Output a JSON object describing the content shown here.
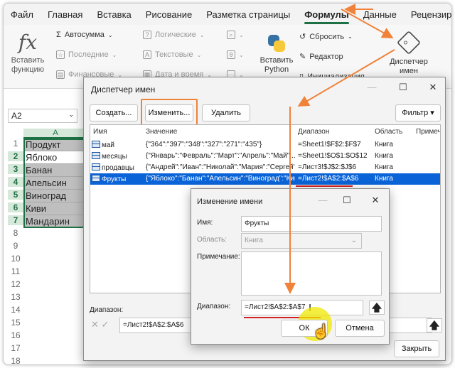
{
  "menu": [
    "Файл",
    "Главная",
    "Вставка",
    "Рисование",
    "Разметка страницы",
    "Формулы",
    "Данные",
    "Рецензиров"
  ],
  "ribbon": {
    "insert_function": "Вставить функцию",
    "fx": "fx",
    "autosum": "Автосумма",
    "recent": "Последние",
    "financial": "Финансовые",
    "logical": "Логические",
    "text": "Текстовые",
    "date_time": "Дата и время",
    "insert_python": "Вставить Python",
    "reset": "Сбросить",
    "editor": "Редактор",
    "init": "Инициализация",
    "name_manager": "Диспетчер имен"
  },
  "namebox": "A2",
  "sheet": {
    "column": "A",
    "rows": [
      "1",
      "2",
      "3",
      "4",
      "5",
      "6",
      "7",
      "8",
      "9",
      "10",
      "11",
      "12",
      "13",
      "14",
      "15",
      "16",
      "17",
      "18"
    ],
    "cells": [
      "Продукт",
      "Яблоко",
      "Банан",
      "Апельсин",
      "Виноград",
      "Киви",
      "Мандарин"
    ]
  },
  "name_manager": {
    "title": "Диспетчер имен",
    "create": "Создать...",
    "edit": "Изменить...",
    "delete": "Удалить",
    "filter": "Фильтр ▾",
    "headers": [
      "Имя",
      "Значение",
      "Диапазон",
      "Область",
      "Примеч"
    ],
    "rows": [
      {
        "name": "май",
        "value": "{\"364\":\"397\":\"348\":\"327\":\"271\":\"435\"}",
        "range": "=Sheet1!$F$2:$F$7",
        "scope": "Книга"
      },
      {
        "name": "месяцы",
        "value": "{\"Январь\":\"Февраль\":\"Март\":\"Апрель\":\"Май\":...",
        "range": "=Sheet1!$O$1:$O$12",
        "scope": "Книга"
      },
      {
        "name": "продавцы",
        "value": "{\"Андрей\":\"Иван\":\"Николай\":\"Мария\":\"Сергей\"}",
        "range": "=Лист3!$J$2:$J$6",
        "scope": "Книга"
      },
      {
        "name": "Фрукты",
        "value": "{\"Яблоко\":\"Банан\":\"Апельсин\":\"Виноград\":\"Кив...",
        "range": "=Лист2!$A$2:$A$6",
        "scope": "Книга"
      }
    ],
    "range_label": "Диапазон:",
    "range_value": "=Лист2!$A$2:$A$6",
    "close": "Закрыть"
  },
  "edit_dialog": {
    "title": "Изменение имени",
    "name_label": "Имя:",
    "name_value": "Фрукты",
    "scope_label": "Область:",
    "scope_value": "Книга",
    "comment_label": "Примечание:",
    "range_label": "Диапазон:",
    "range_value": "=Лист2!$A$2:$A$7",
    "ok": "ОК",
    "cancel": "Отмена"
  }
}
